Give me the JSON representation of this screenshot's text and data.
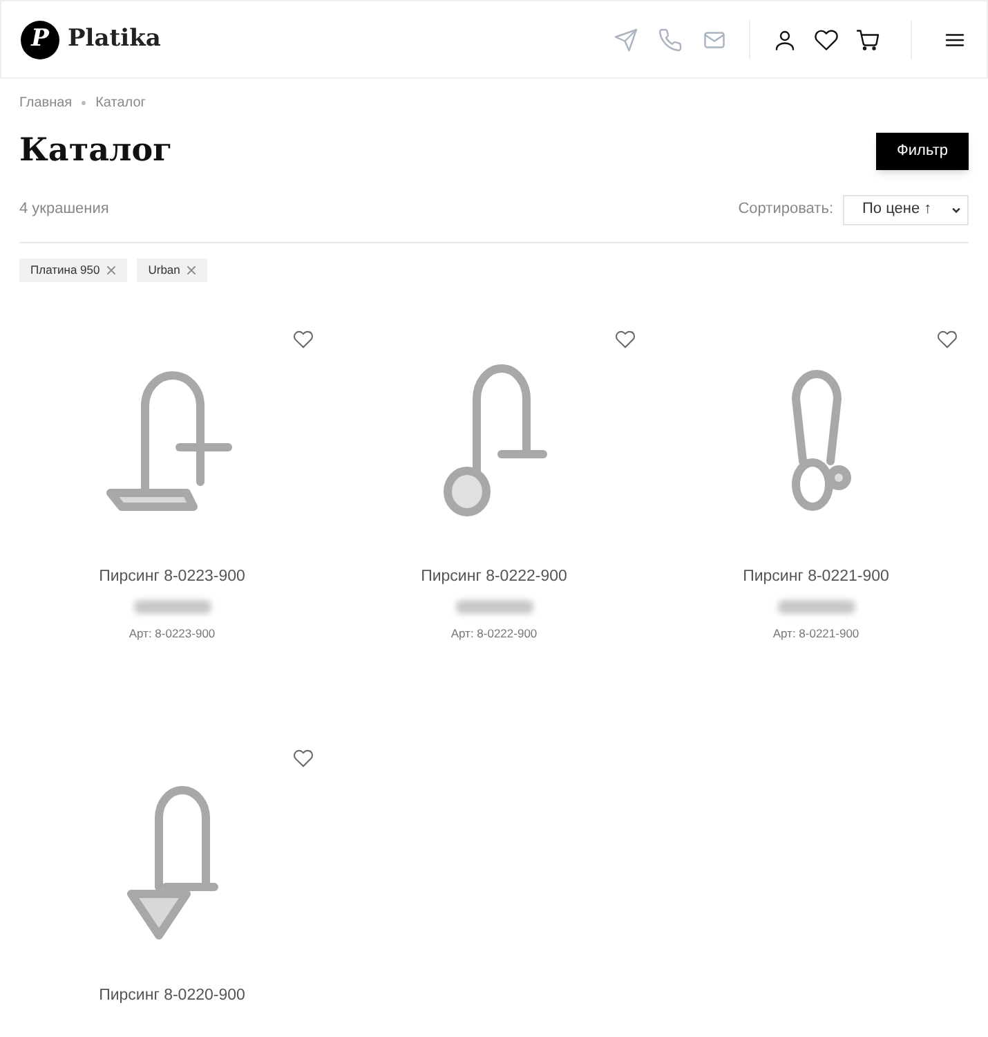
{
  "header": {
    "logo_mark": "P",
    "brand": "Platika"
  },
  "breadcrumbs": [
    {
      "label": "Главная"
    },
    {
      "label": "Каталог"
    }
  ],
  "title": "Каталог",
  "filter_button": "Фильтр",
  "count": "4 украшения",
  "sort": {
    "label": "Сортировать:",
    "value": "По цене ↑"
  },
  "active_filters": [
    {
      "label": "Платина 950"
    },
    {
      "label": "Urban"
    }
  ],
  "products": [
    {
      "kind": "hook",
      "name": "Пирсинг 8-0223-900",
      "article": "Арт: 8-0223-900",
      "price_blurred": true
    },
    {
      "kind": "disc",
      "name": "Пирсинг 8-0222-900",
      "article": "Арт: 8-0222-900",
      "price_blurred": true
    },
    {
      "kind": "ring",
      "name": "Пирсинг 8-0221-900",
      "article": "Арт: 8-0221-900",
      "price_blurred": true
    },
    {
      "kind": "arrow",
      "name": "Пирсинг 8-0220-900",
      "price_blurred": false
    }
  ]
}
